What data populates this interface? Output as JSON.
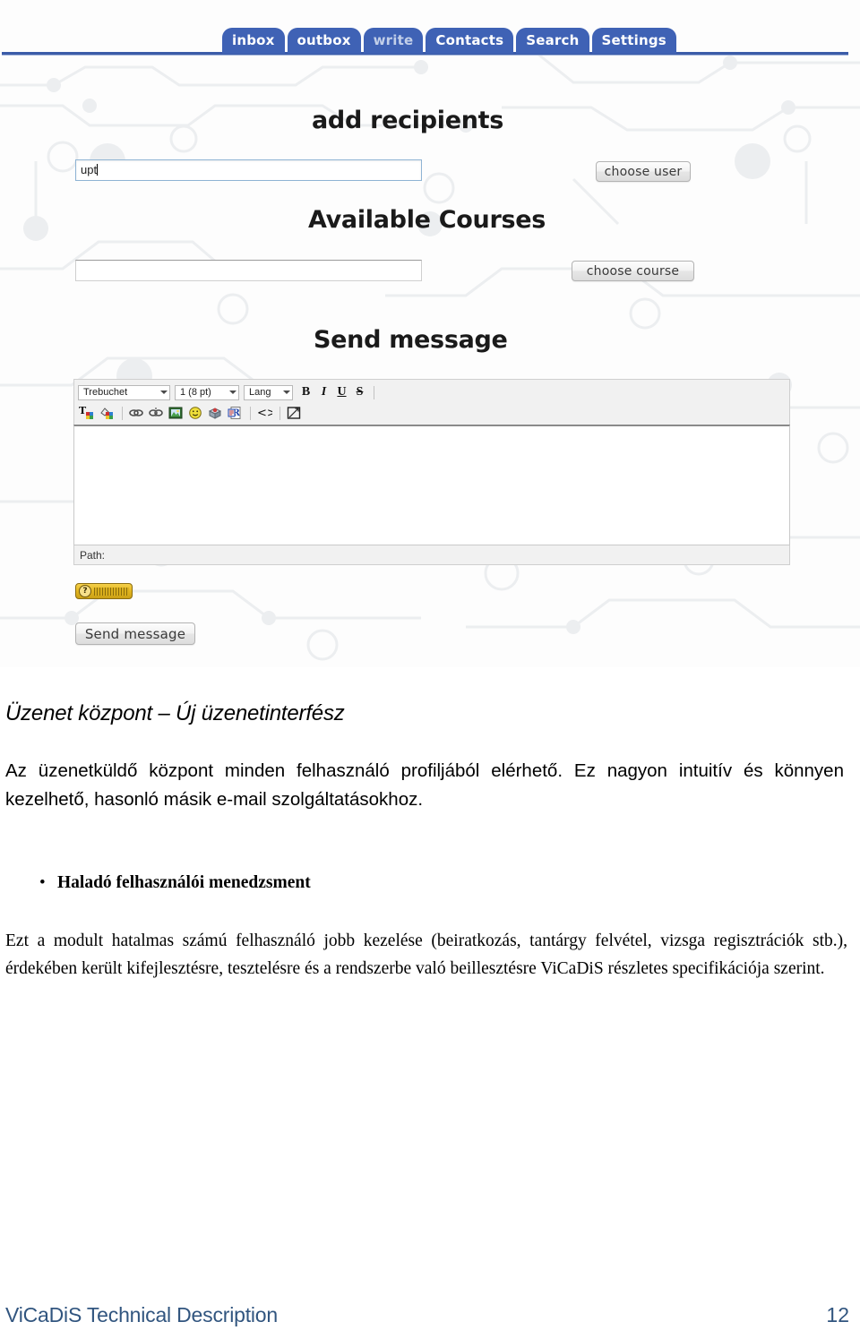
{
  "screenshot": {
    "tabs": [
      {
        "label": "inbox",
        "active": false
      },
      {
        "label": "outbox",
        "active": false
      },
      {
        "label": "write",
        "active": true
      },
      {
        "label": "Contacts",
        "active": false
      },
      {
        "label": "Search",
        "active": false
      },
      {
        "label": "Settings",
        "active": false
      }
    ],
    "recipients": {
      "heading": "add recipients",
      "input_value": "upt",
      "input_placeholder": "",
      "button_label": "choose user"
    },
    "courses": {
      "heading": "Available Courses",
      "input_value": "",
      "input_placeholder": "",
      "button_label": "choose course"
    },
    "compose": {
      "heading": "Send message",
      "toolbar": {
        "font_family": "Trebuchet",
        "font_size": "1 (8 pt)",
        "language": "Lang",
        "bold": "B",
        "italic": "I",
        "underline": "U",
        "strikethrough": "S",
        "icons": [
          "text-color-icon",
          "background-color-icon",
          "insert-link-icon",
          "unlink-icon",
          "insert-image-icon",
          "insert-emoticon-icon",
          "insert-media-icon",
          "find-replace-icon",
          "source-code-icon",
          "fullscreen-icon"
        ]
      },
      "body_value": "",
      "path_label": "Path:",
      "help_badge_label": "?",
      "send_button_label": "Send message"
    },
    "colors": {
      "tab_blue": "#3f62b5",
      "tab_active_text": "#c2cfe9",
      "rule_blue": "#3b5ca8",
      "badge_gold": "#e2b520"
    }
  },
  "document": {
    "heading": "Üzenet központ – Új üzenetinterfész",
    "paragraph": "Az üzenetküldő központ minden felhasználó profiljából elérhető. Ez nagyon intuitív és könnyen kezelhető, hasonló másik e-mail szolgáltatásokhoz.",
    "bullet_item": "Haladó felhasználói menedzsment",
    "bullet_marker": "•",
    "bullet_paragraph": "Ezt a modult hatalmas számú felhasználó jobb kezelése (beiratkozás, tantárgy felvétel, vizsga regisztrációk stb.), érdekében került kifejlesztésre, tesztelésre és a rendszerbe való beillesztésre ViCaDiS részletes specifikációja szerint."
  },
  "footer": {
    "title": "ViCaDiS Technical Description",
    "page_number": "12",
    "color": "#31557f"
  }
}
